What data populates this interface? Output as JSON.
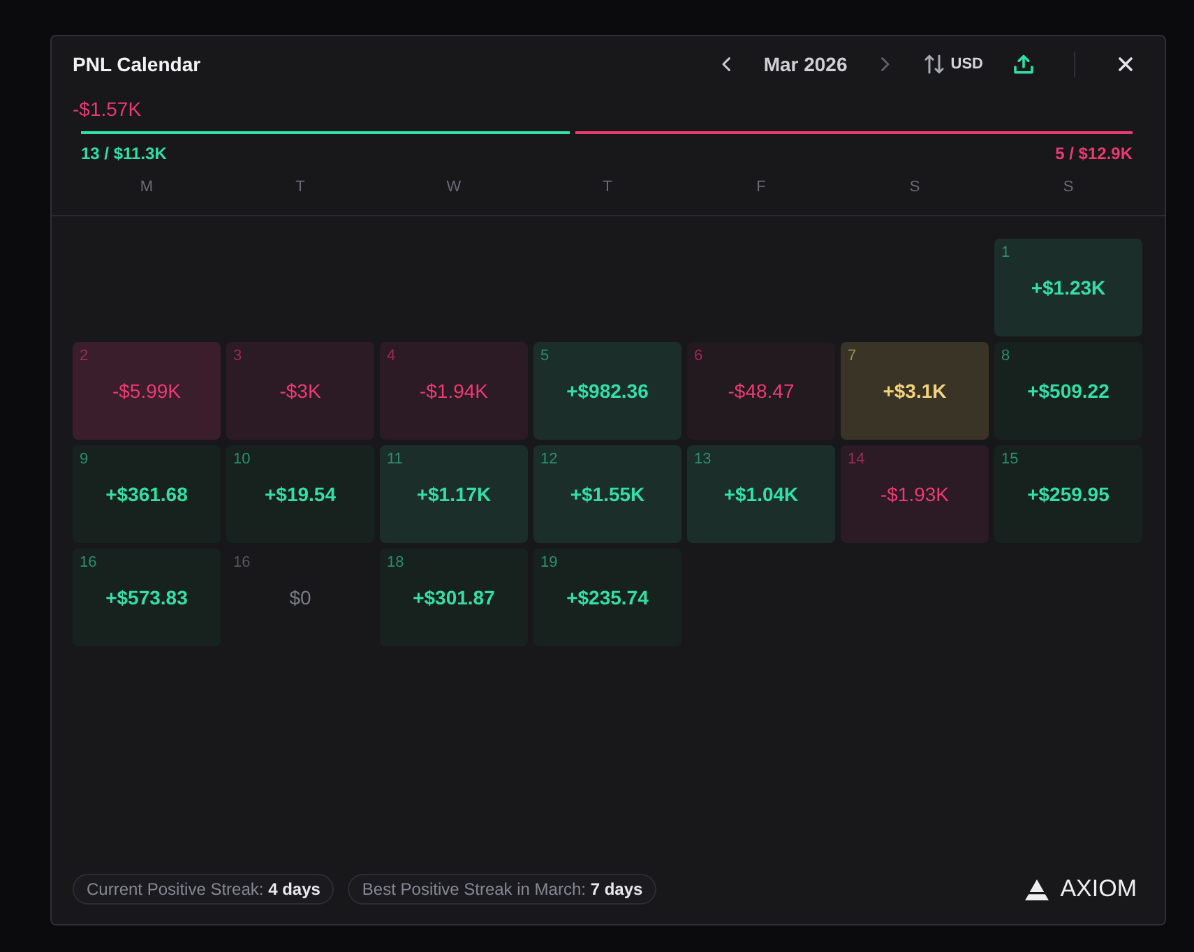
{
  "modal": {
    "title": "PNL Calendar",
    "month_nav": {
      "label": "Mar 2026",
      "prev_disabled": false,
      "next_disabled": true
    },
    "currency": {
      "label": "USD"
    }
  },
  "summary": {
    "total": "-$1.57K",
    "negative": true,
    "level": 0.465,
    "wins": "13 / $11.3K",
    "losses": "5 / $12.9K"
  },
  "weekdays": [
    "M",
    "T",
    "W",
    "T",
    "F",
    "S",
    "S"
  ],
  "weeks": [
    [
      {
        "kind": "empty"
      },
      {
        "kind": "empty"
      },
      {
        "kind": "empty"
      },
      {
        "kind": "empty"
      },
      {
        "kind": "empty"
      },
      {
        "kind": "empty"
      },
      {
        "day": "1",
        "value": "+$1.23K",
        "kind": "gain",
        "color": "#1b2e2a"
      }
    ],
    [
      {
        "day": "2",
        "value": "-$5.99K",
        "kind": "loss",
        "color": "#3a1e2b"
      },
      {
        "day": "3",
        "value": "-$3K",
        "kind": "loss",
        "color": "#2c1b24"
      },
      {
        "day": "4",
        "value": "-$1.94K",
        "kind": "loss",
        "color": "#2c1b24"
      },
      {
        "day": "5",
        "value": "+$982.36",
        "kind": "gain",
        "color": "#1b2e2a"
      },
      {
        "day": "6",
        "value": "-$48.47",
        "kind": "loss",
        "color": "#221a1f"
      },
      {
        "day": "7",
        "value": "+$3.1K",
        "kind": "best",
        "color": "#3a3427"
      },
      {
        "day": "8",
        "value": "+$509.22",
        "kind": "gain",
        "color": "#17221f"
      }
    ],
    [
      {
        "day": "9",
        "value": "+$361.68",
        "kind": "gain",
        "color": "#17221f"
      },
      {
        "day": "10",
        "value": "+$19.54",
        "kind": "gain",
        "color": "#17221f"
      },
      {
        "day": "11",
        "value": "+$1.17K",
        "kind": "gain",
        "color": "#1b2e2a"
      },
      {
        "day": "12",
        "value": "+$1.55K",
        "kind": "gain",
        "color": "#1b2e2a"
      },
      {
        "day": "13",
        "value": "+$1.04K",
        "kind": "gain",
        "color": "#1b2e2a"
      },
      {
        "day": "14",
        "value": "-$1.93K",
        "kind": "loss",
        "color": "#2c1b24"
      },
      {
        "day": "15",
        "value": "+$259.95",
        "kind": "gain",
        "color": "#17221f"
      }
    ],
    [
      {
        "day": "16",
        "value": "+$573.83",
        "kind": "gain",
        "color": "#17221f"
      },
      {
        "day": "16",
        "value": "$0",
        "kind": "flat"
      },
      {
        "day": "18",
        "value": "+$301.87",
        "kind": "gain",
        "color": "#17221f"
      },
      {
        "day": "19",
        "value": "+$235.74",
        "kind": "gain",
        "color": "#17221f"
      }
    ]
  ],
  "streaks": [
    "Current Positive Streak: **4 days**",
    "Best Positive Streak in March: **7 days**"
  ],
  "brand": {
    "name": "AXIOM"
  }
}
